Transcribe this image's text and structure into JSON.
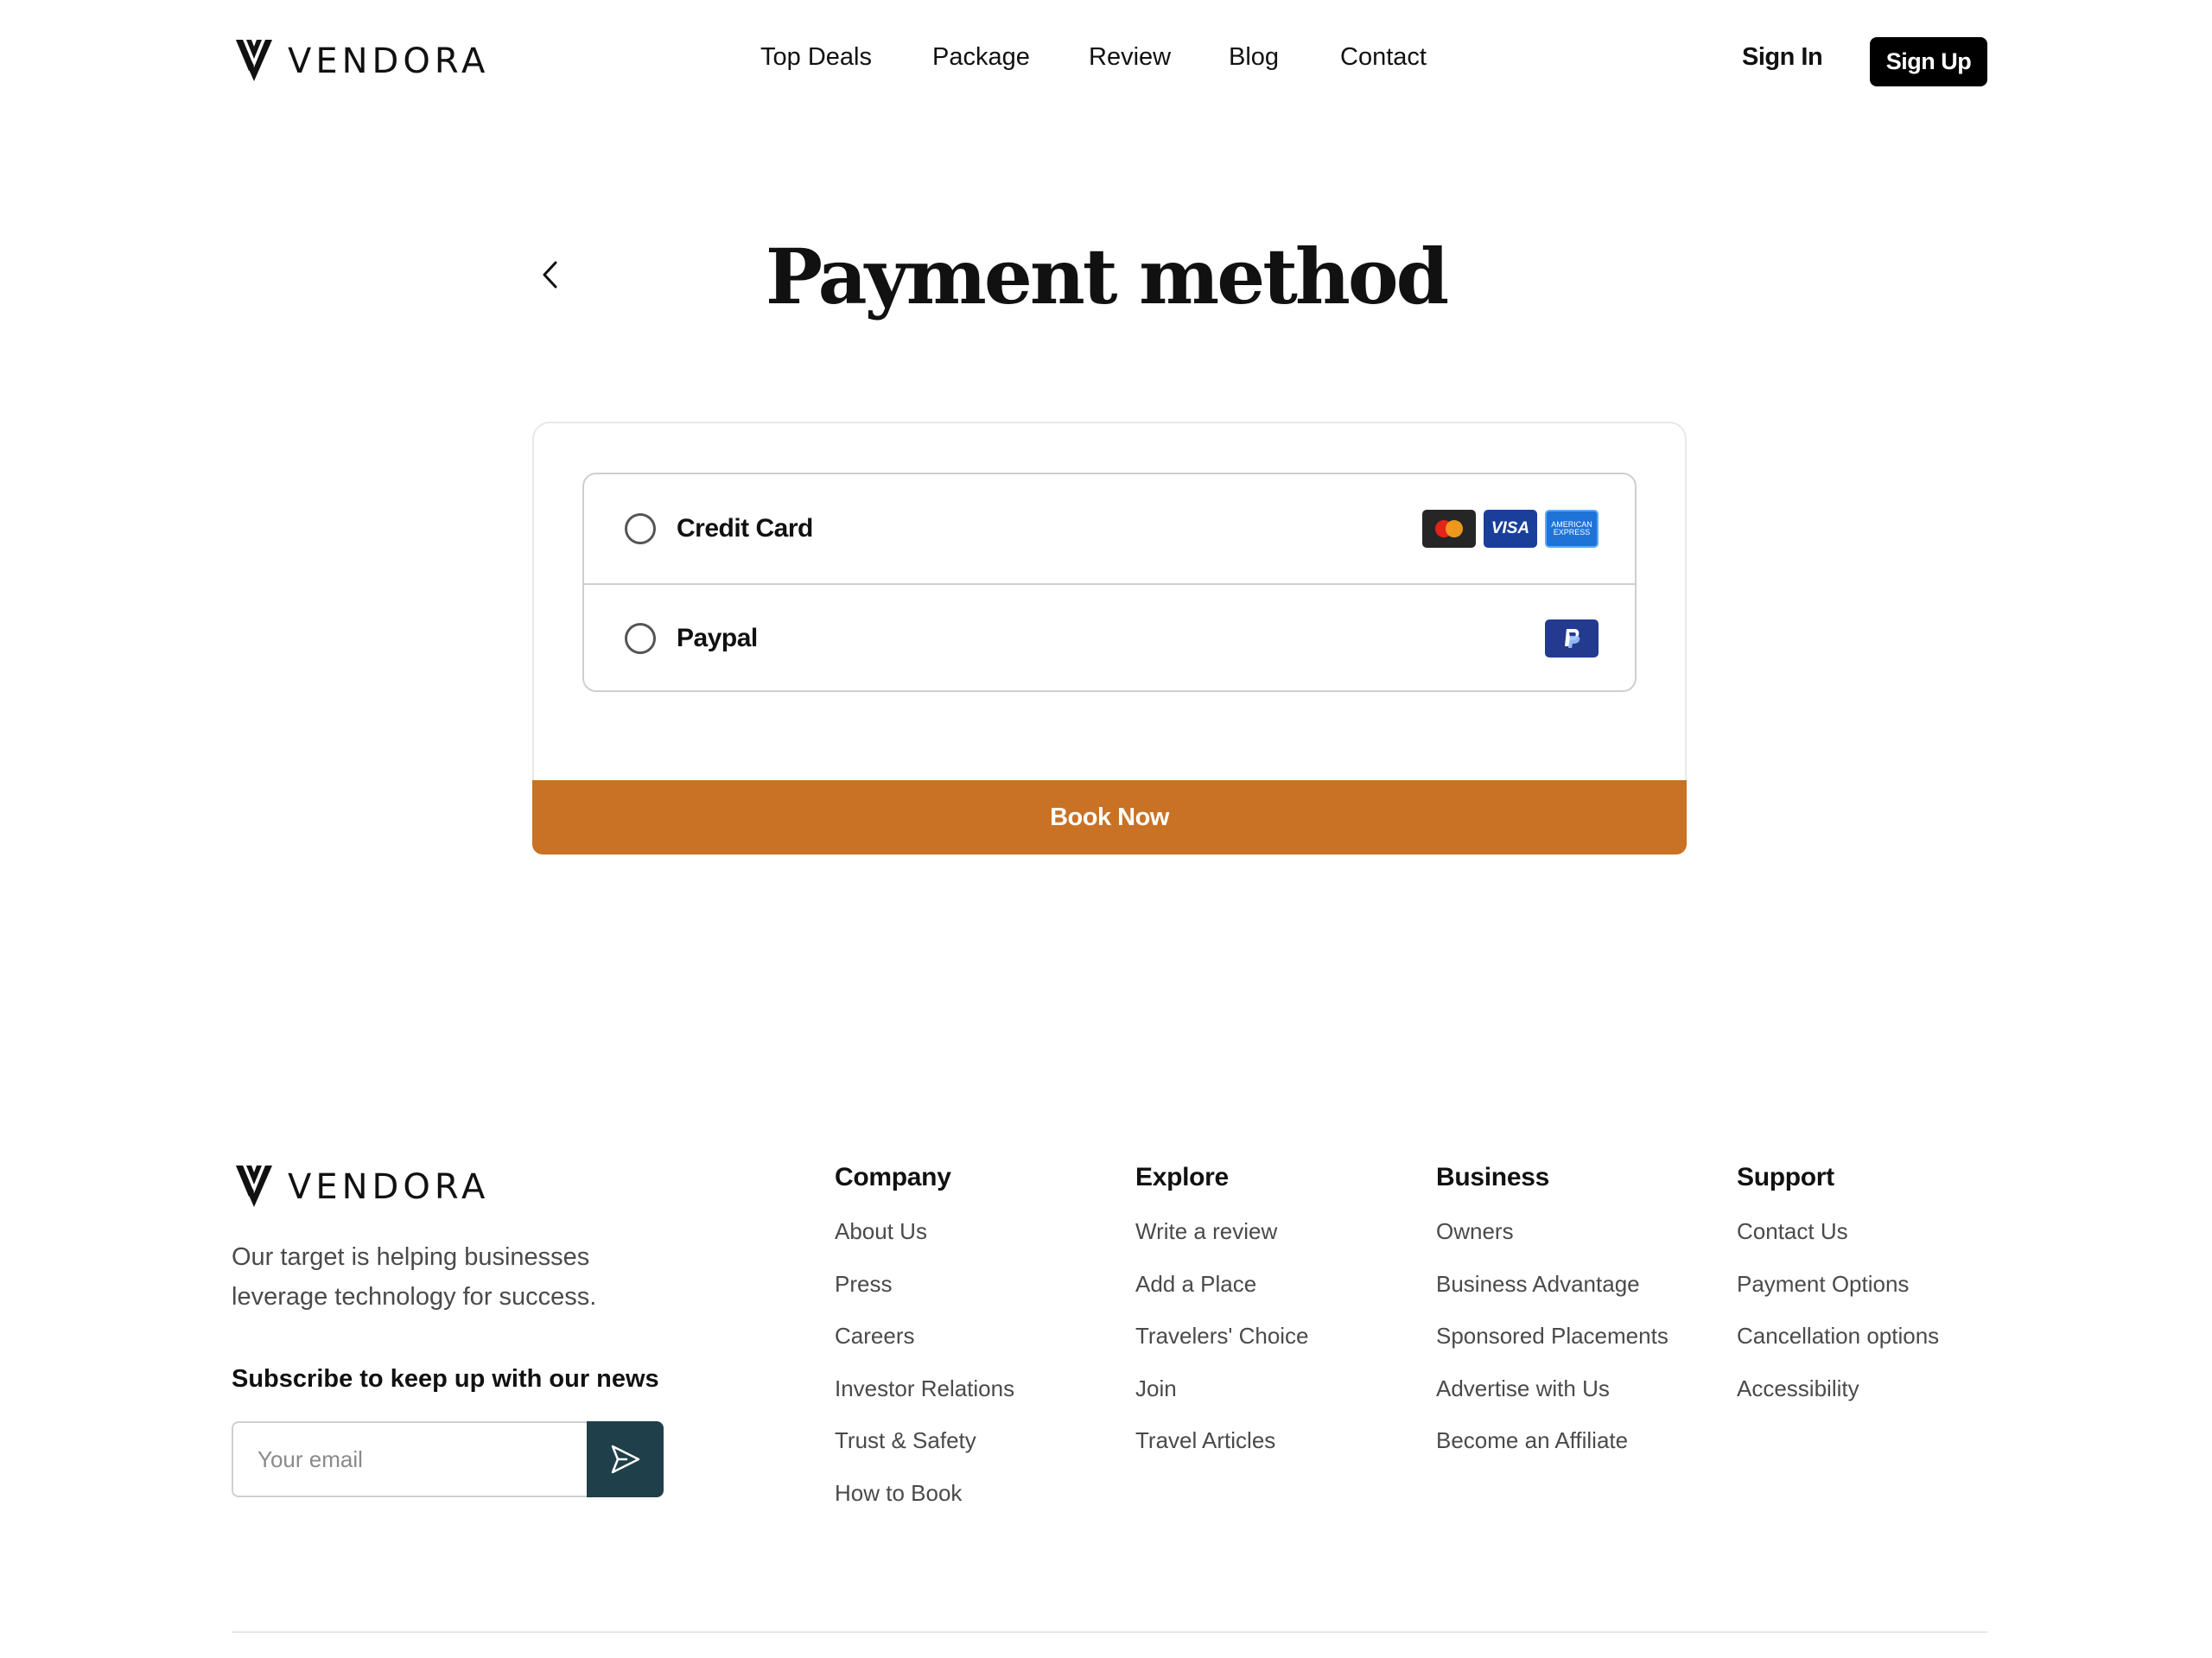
{
  "header": {
    "brand": "VENDORA",
    "nav": [
      "Top Deals",
      "Package",
      "Review",
      "Blog",
      "Contact"
    ],
    "sign_in": "Sign In",
    "sign_up": "Sign Up"
  },
  "main": {
    "title": "Payment method",
    "options": [
      {
        "label": "Credit Card",
        "logos": [
          "mastercard",
          "visa",
          "american-express"
        ]
      },
      {
        "label": "Paypal",
        "logos": [
          "paypal"
        ]
      }
    ],
    "visa_text": "VISA",
    "amex_text_1": "AMERICAN",
    "amex_text_2": "EXPRESS",
    "book_label": "Book Now"
  },
  "footer": {
    "brand": "VENDORA",
    "tagline": "Our target is helping businesses leverage technology for success.",
    "subscribe_title": "Subscribe to keep up with our news",
    "email_placeholder": "Your email",
    "columns": [
      {
        "title": "Company",
        "links": [
          "About Us",
          "Press",
          "Careers",
          "Investor Relations",
          "Trust & Safety",
          "How to Book"
        ]
      },
      {
        "title": "Explore",
        "links": [
          "Write a review",
          "Add a Place",
          "Travelers' Choice",
          "Join",
          "Travel Articles"
        ]
      },
      {
        "title": "Business",
        "links": [
          "Owners",
          "Business Advantage",
          "Sponsored Placements",
          "Advertise with Us",
          "Become an Affiliate"
        ]
      },
      {
        "title": "Support",
        "links": [
          "Contact Us",
          "Payment Options",
          "Cancellation options",
          "Accessibility"
        ]
      }
    ]
  },
  "colors": {
    "accent": "#c97124",
    "send_button": "#1f3f4a",
    "sign_up_bg": "#000000"
  }
}
